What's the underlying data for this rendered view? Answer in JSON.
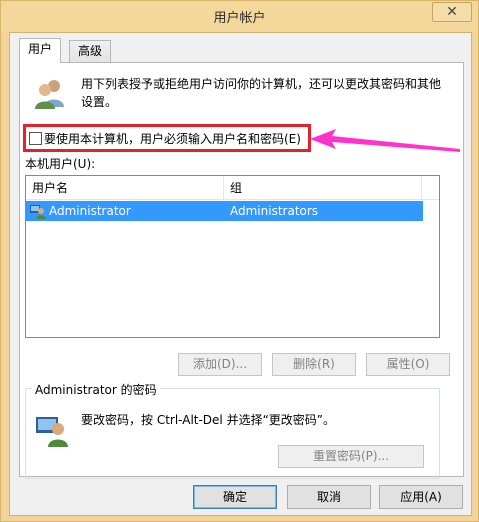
{
  "window": {
    "title": "用户帐户",
    "close_glyph": "✕"
  },
  "tabs": [
    {
      "label": "用户"
    },
    {
      "label": "高级"
    }
  ],
  "intro_text": "用下列表授予或拒绝用户访问你的计算机，还可以更改其密码和其他设置。",
  "require_password": {
    "label": "要使用本计算机，用户必须输入用户名和密码(E)",
    "checked": false
  },
  "local_users_label": "本机用户(U):",
  "table": {
    "columns": [
      "用户名",
      "组"
    ],
    "rows": [
      {
        "name": "Administrator",
        "group": "Administrators",
        "selected": true
      }
    ]
  },
  "buttons": {
    "add": "添加(D)...",
    "remove": "删除(R)",
    "properties": "属性(O)"
  },
  "password_group": {
    "title": "Administrator 的密码",
    "text": "要改密码，按 Ctrl-Alt-Del 并选择“更改密码”。",
    "reset_button": "重置密码(P)..."
  },
  "footer": {
    "ok": "确定",
    "cancel": "取消",
    "apply": "应用(A)"
  },
  "colors": {
    "annotation_box": "#e3232b",
    "annotation_arrow": "#ff33cc",
    "selection": "#3399ff"
  },
  "icons": {
    "users": "users-icon",
    "user_row": "user-icon",
    "password": "password-user-icon",
    "close": "close-icon"
  }
}
